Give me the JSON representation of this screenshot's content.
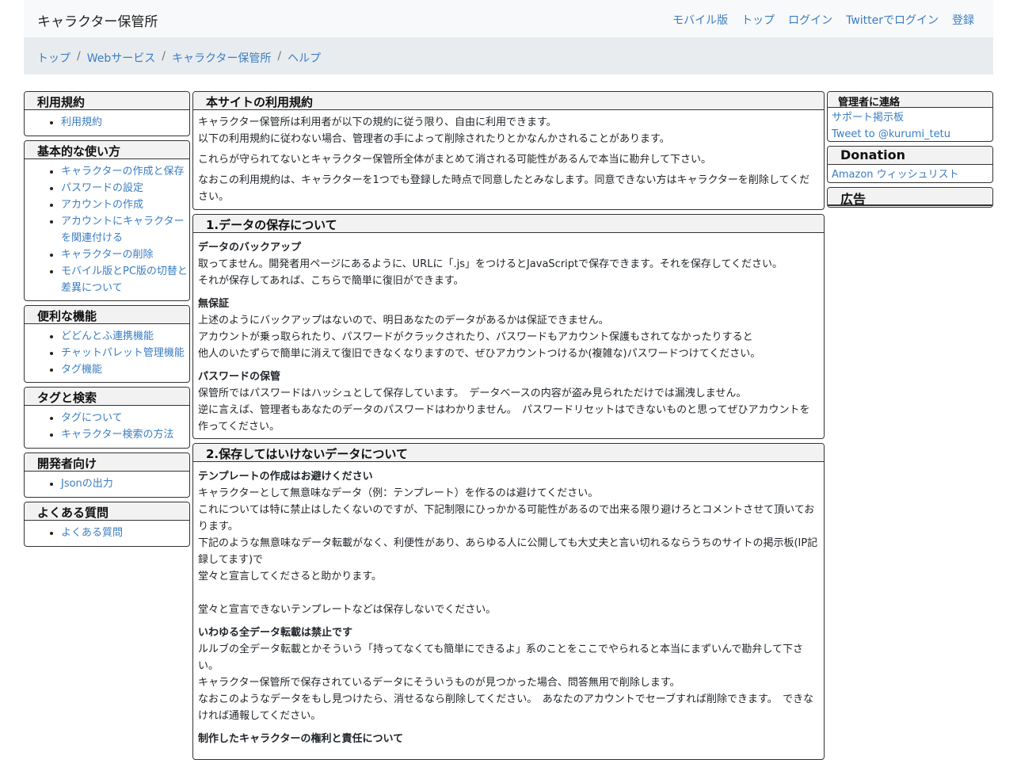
{
  "navbar": {
    "brand": "キャラクター保管所",
    "links": [
      "モバイル版",
      "トップ",
      "ログイン",
      "Twitterでログイン",
      "登録"
    ]
  },
  "breadcrumb": [
    "トップ",
    "Webサービス",
    "キャラクター保管所",
    "ヘルプ"
  ],
  "sidebar": [
    {
      "title": "利用規約",
      "items": [
        "利用規約"
      ]
    },
    {
      "title": "基本的な使い方",
      "items": [
        "キャラクターの作成と保存",
        "パスワードの設定",
        "アカウントの作成",
        "アカウントにキャラクターを関連付ける",
        "キャラクターの削除",
        "モバイル版とPC版の切替と差異について"
      ]
    },
    {
      "title": "便利な機能",
      "items": [
        "どどんとふ連携機能",
        "チャットパレット管理機能",
        "タグ機能"
      ]
    },
    {
      "title": "タグと検索",
      "items": [
        "タグについて",
        "キャラクター検索の方法"
      ]
    },
    {
      "title": "開発者向け",
      "items": [
        "Jsonの出力"
      ]
    },
    {
      "title": "よくある質問",
      "items": [
        "よくある質問"
      ]
    }
  ],
  "main": {
    "terms": {
      "title": "本サイトの利用規約",
      "p1": "キャラクター保管所は利用者が以下の規約に従う限り、自由に利用できます。",
      "p2": "以下の利用規約に従わない場合、管理者の手によって削除されたりとかなんかされることがあります。",
      "p3": "これらが守られてないとキャラクター保管所全体がまとめて消される可能性があるんで本当に勘弁して下さい。",
      "p4": "なおこの利用規約は、キャラクターを1つでも登録した時点で同意したとみなします。同意できない方はキャラクターを削除してください。"
    },
    "section1": {
      "title": "1.データの保存について",
      "backup_h": "データのバックアップ",
      "backup_1": "取ってません。開発者用ページにあるように、URLに「.js」をつけるとJavaScriptで保存できます。それを保存してください。",
      "backup_2": "それが保存してあれば、こちらで簡単に復旧ができます。",
      "noguarantee_h": "無保証",
      "noguarantee_1": "上述のようにバックアップはないので、明日あなたのデータがあるかは保証できません。",
      "noguarantee_2": "アカウントが乗っ取られたり、パスワードがクラックされたり、パスワードもアカウント保護もされてなかったりすると",
      "noguarantee_3": "他人のいたずらで簡単に消えて復旧できなくなりますので、ぜひアカウントつけるか(複雑な)パスワードつけてください。",
      "password_h": "パスワードの保管",
      "password_1": "保管所ではパスワードはハッシュとして保存しています。　データベースの内容が盗み見られただけでは漏洩しません。",
      "password_2": "逆に言えば、管理者もあなたのデータのパスワードはわかりません。　パスワードリセットはできないものと思ってぜひアカウントを作ってください。"
    },
    "section2": {
      "title": "2.保存してはいけないデータについて",
      "template_h": "テンプレートの作成はお避けください",
      "template_1": "キャラクターとして無意味なデータ（例：テンプレート）を作るのは避けてください。",
      "template_2": "これについては特に禁止はしたくないのですが、下記制限にひっかかる可能性があるので出来る限り避けろとコメントさせて頂いております。",
      "template_3": "下記のような無意味なデータ転載がなく、利便性があり、あらゆる人に公開しても大丈夫と言い切れるならうちのサイトの掲示板(IP記録してます)で",
      "template_4": "堂々と宣言してくださると助かります。",
      "template_5": "堂々と宣言できないテンプレートなどは保存しないでください。",
      "copy_h": "いわゆる全データ転載は禁止です",
      "copy_1": "ルルブの全データ転載とかそういう「持ってなくても簡単にできるよ」系のことをここでやられると本当にまずいんで勘弁して下さい。",
      "copy_2": "キャラクター保管所で保存されているデータにそういうものが見つかった場合、問答無用で削除します。",
      "copy_3": "なおこのようなデータをもし見つけたら、消せるなら削除してください。　あなたのアカウントでセーブすれば削除できます。　できなければ通報してください。",
      "rights_h": "制作したキャラクターの権利と責任について"
    }
  },
  "right": {
    "contact_title": "管理者に連絡",
    "contact_links": [
      "サポート掲示板",
      "Tweet to @kurumi_tetu"
    ],
    "donation_title": "Donation",
    "donation_link": "Amazon ウィッシュリスト",
    "ad_title": "広告"
  }
}
